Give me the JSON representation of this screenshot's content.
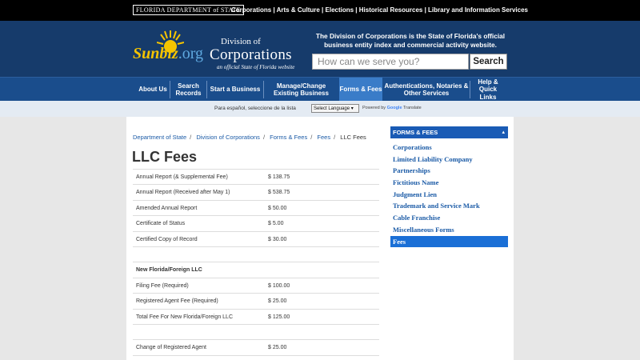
{
  "topbar": {
    "dos_logo": "FLORIDA DEPARTMENT of STATE",
    "links_text": "Corporations | Arts & Culture | Elections | Historical Resources | Library and Information Services"
  },
  "header": {
    "logo_sunbiz": "Sunbiz",
    "logo_org": ".org",
    "logo_division": "Division of",
    "logo_corporations": "Corporations",
    "logo_tagline": "an official State of Florida website",
    "description": "The Division of Corporations is the State of Florida's official business entity index and commercial activity website.",
    "search_placeholder": "How can we serve you?",
    "search_button": "Search"
  },
  "nav": {
    "items": [
      {
        "label": "About Us"
      },
      {
        "label": "Search Records"
      },
      {
        "label": "Start a Business"
      },
      {
        "label": "Manage/Change Existing Business"
      },
      {
        "label": "Forms & Fees"
      },
      {
        "label": "Authentications, Notaries & Other Services"
      },
      {
        "label": "Help & Quick Links"
      }
    ]
  },
  "langbar": {
    "text": "Para español, seleccione de la lista",
    "select_value": "Select Language ▾",
    "powered_by": "Powered by",
    "google": "Google",
    "translate": "Translate"
  },
  "breadcrumb": {
    "items": [
      "Department of State",
      "Division of Corporations",
      "Forms & Fees",
      "Fees"
    ],
    "current": "LLC Fees"
  },
  "page": {
    "title": "LLC Fees"
  },
  "fees": [
    {
      "name": "Annual Report (& Supplemental Fee)",
      "amount": "$ 138.75"
    },
    {
      "name": "Annual Report (Received after May 1)",
      "amount": "$ 538.75"
    },
    {
      "name": "Amended Annual Report",
      "amount": "$ 50.00"
    },
    {
      "name": "Certificate of Status",
      "amount": "$ 5.00"
    },
    {
      "name": "Certified Copy of Record",
      "amount": "$ 30.00"
    },
    {
      "name": "",
      "amount": ""
    },
    {
      "name": "New Florida/Foreign LLC",
      "amount": ""
    },
    {
      "name": "Filing Fee (Required)",
      "amount": "$ 100.00"
    },
    {
      "name": "Registered Agent Fee (Required)",
      "amount": "$ 25.00"
    },
    {
      "name": "Total Fee For New Florida/Foreign LLC",
      "amount": "$ 125.00"
    },
    {
      "name": "",
      "amount": ""
    },
    {
      "name": "Change of Registered Agent",
      "amount": "$ 25.00"
    }
  ],
  "sidebar": {
    "heading": "FORMS & FEES",
    "caret": "▴",
    "items": [
      {
        "label": "Corporations"
      },
      {
        "label": "Limited Liability Company"
      },
      {
        "label": "Partnerships"
      },
      {
        "label": "Fictitious Name"
      },
      {
        "label": "Judgment Lien"
      },
      {
        "label": "Trademark and Service Mark"
      },
      {
        "label": "Cable Franchise"
      },
      {
        "label": "Miscellaneous Forms"
      },
      {
        "label": "Fees"
      }
    ]
  }
}
